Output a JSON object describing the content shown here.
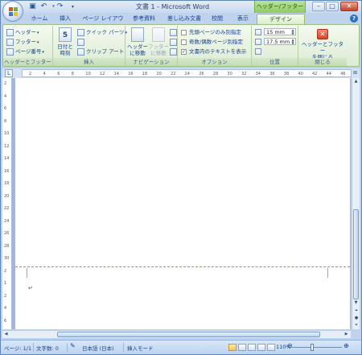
{
  "window": {
    "title": "文書 1 - Microsoft Word",
    "contextual_tab_title": "ヘッダー/フッター ツ..."
  },
  "tabs": [
    "ホーム",
    "挿入",
    "ページ レイアウト",
    "参考資料",
    "差し込み文書",
    "校閲",
    "表示",
    "デザイン"
  ],
  "ribbon": {
    "group_header_footer": {
      "label": "ヘッダーとフッター",
      "header": "ヘッダー",
      "footer": "フッター",
      "page_number": "ページ番号"
    },
    "group_insert": {
      "label": "挿入",
      "date_time": [
        "日付と",
        "時刻"
      ],
      "quick_parts": "クイック パーツ",
      "clip_art": "クリップ アート"
    },
    "group_navigation": {
      "label": "ナビゲーション",
      "goto_header": [
        "ヘッダー",
        "に移動"
      ],
      "goto_footer": [
        "フッター",
        "に移動"
      ]
    },
    "group_options": {
      "label": "オプション",
      "different_first": "先頭ページのみ別指定",
      "different_odd_even": "奇数/偶数ページ別指定",
      "show_doc_text": "文書内のテキストを表示"
    },
    "group_position": {
      "label": "位置",
      "header_pos": "15 mm",
      "footer_pos": "17.5 mm"
    },
    "group_close": {
      "label": "閉じる",
      "close_button": [
        "ヘッダーとフッター",
        "を閉じる"
      ]
    }
  },
  "ruler_marks": [
    "2",
    "4",
    "6",
    "8",
    "10",
    "12",
    "14",
    "16",
    "18",
    "20",
    "22",
    "24",
    "26",
    "28",
    "30",
    "32",
    "34",
    "36",
    "38",
    "40",
    "42",
    "44",
    "46"
  ],
  "vruler_marks": [
    "2",
    "4",
    "6",
    "8",
    "10",
    "12",
    "14",
    "16",
    "18",
    "20",
    "22",
    "24",
    "26",
    "28",
    "30",
    "2",
    "1",
    "2",
    "4",
    "6"
  ],
  "statusbar": {
    "page": "ページ: 1/1",
    "word_count": "文字数: 0",
    "language": "日本語 (日本)",
    "mode": "挿入モード",
    "zoom": "110%"
  },
  "colors": {
    "contextual_green": "#8fcb62",
    "ribbon_bg": "#dcecd3",
    "close_red": "#d9412b"
  }
}
